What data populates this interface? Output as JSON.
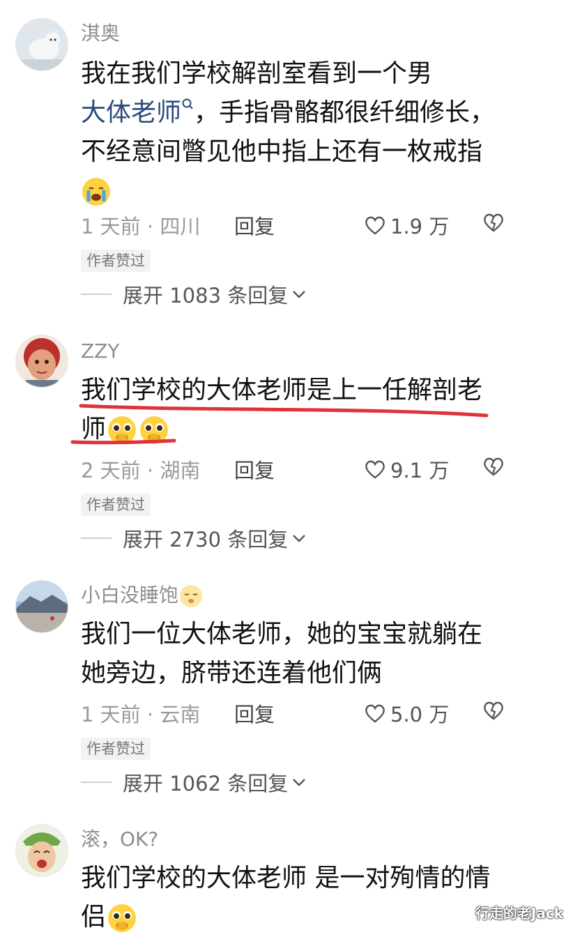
{
  "comments": [
    {
      "username": "淇奥",
      "body_line1": "我在我们学校解剖室看到一个男",
      "body_link": "大体老师",
      "body_line2_rest": "，手指骨骼都很纤细修长，",
      "body_line3": "不经意间瞥见他中指上还有一枚戒指",
      "time_location": "1 天前 · 四川",
      "reply_label": "回复",
      "likes": "1.9 万",
      "author_badge": "作者赞过",
      "expand_text": "展开 1083 条回复"
    },
    {
      "username": "ZZY",
      "body_line1": "我们学校的大体老师是上一任解剖老",
      "body_line2": "师",
      "time_location": "2 天前 · 湖南",
      "reply_label": "回复",
      "likes": "9.1 万",
      "author_badge": "作者赞过",
      "expand_text": "展开 2730 条回复"
    },
    {
      "username": "小白没睡饱",
      "body_line1": "我们一位大体老师，她的宝宝就躺在",
      "body_line2": "她旁边，脐带还连着他们俩",
      "time_location": "1 天前 · 云南",
      "reply_label": "回复",
      "likes": "5.0 万",
      "author_badge": "作者赞过",
      "expand_text": "展开 1062 条回复"
    },
    {
      "username": "滚，OK?",
      "body_line1": "我们学校的大体老师 是一对殉情的情",
      "body_line2": "侣"
    }
  ],
  "watermark": "行走的老Jack",
  "colors": {
    "link": "#2a4a78",
    "underline": "#e0323a",
    "emoji_yellow": "#ffd23f"
  },
  "icons": [
    "heart-outline-icon",
    "broken-heart-icon",
    "chevron-down-icon",
    "search-icon",
    "crying-emoji-icon",
    "pleading-emoji-icon",
    "sleepy-emoji-icon"
  ]
}
